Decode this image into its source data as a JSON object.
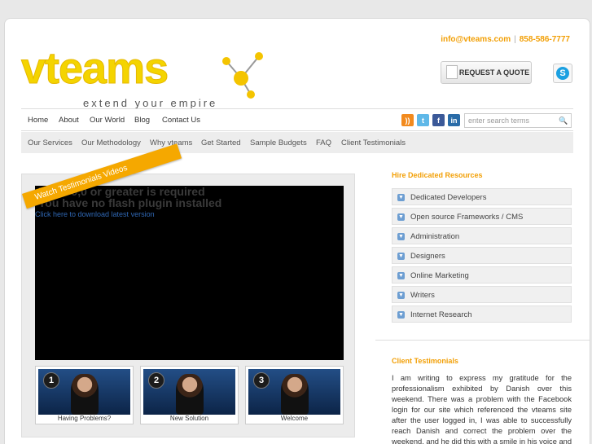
{
  "header": {
    "brand": "vteams",
    "tagline": "extend your empire",
    "email": "info@vteams.com",
    "separator": "|",
    "phone": "858-586-7777",
    "quote_label": "REQUEST A QUOTE",
    "skype_icon": "skype-icon",
    "colors": {
      "brand_yellow": "#f4d400",
      "accent_orange": "#f29f05",
      "link_blue": "#2f67b3"
    }
  },
  "topnav": {
    "items": [
      "Home",
      "About",
      "Our World",
      "Blog",
      "Contact Us"
    ],
    "social_icons": [
      "rss-icon",
      "twitter-icon",
      "facebook-icon",
      "linkedin-icon"
    ],
    "search_placeholder": "enter search terms"
  },
  "subnav": {
    "items": [
      "Our Services",
      "Our Methodology",
      "Why vteams",
      "Get Started",
      "Sample Budgets",
      "FAQ",
      "Client Testimonials"
    ]
  },
  "video": {
    "ribbon": "Watch Testimonials Videos",
    "flash_line1": "Flash 9,0 or greater is required",
    "flash_line2": "You have no flash plugin installed",
    "flash_link": "Click here to download latest version",
    "thumbs": [
      {
        "num": "1",
        "caption": "Having Problems?"
      },
      {
        "num": "2",
        "caption": "New Solution"
      },
      {
        "num": "3",
        "caption": "Welcome"
      }
    ]
  },
  "resources": {
    "title": "Hire Dedicated Resources",
    "items": [
      "Dedicated Developers",
      "Open source Frameworks / CMS",
      "Administration",
      "Designers",
      "Online Marketing",
      "Writers",
      "Internet Research"
    ]
  },
  "testimonials": {
    "title": "Client Testimonials",
    "text": "I am writing to express my gratitude for the professionalism exhibited by Danish over this weekend. There was a problem with the Facebook login for our site which referenced the vteams site after the user logged in, I was able to successfully reach Danish and correct the problem over the weekend, and he did this with a smile in his voice and attitude."
  }
}
